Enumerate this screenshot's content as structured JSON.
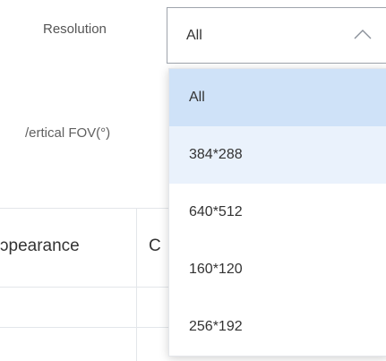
{
  "filters": {
    "resolution_label": "Resolution",
    "vertical_fov_label": "/ertical FOV(°)"
  },
  "resolution_select": {
    "value": "All",
    "options": [
      {
        "label": "All",
        "state": "selected"
      },
      {
        "label": "384*288",
        "state": "hover"
      },
      {
        "label": "640*512",
        "state": "normal"
      },
      {
        "label": "160*120",
        "state": "normal"
      },
      {
        "label": "256*192",
        "state": "normal"
      }
    ]
  },
  "table": {
    "headers": [
      "ɔpearance",
      "C"
    ]
  },
  "colors": {
    "selected_bg": "#cfe2f8",
    "hover_bg": "#eaf2fc",
    "border": "#9ea4ac",
    "grid": "#e3e6ea"
  },
  "icons": {
    "select_toggle": "chevron-up-icon"
  }
}
